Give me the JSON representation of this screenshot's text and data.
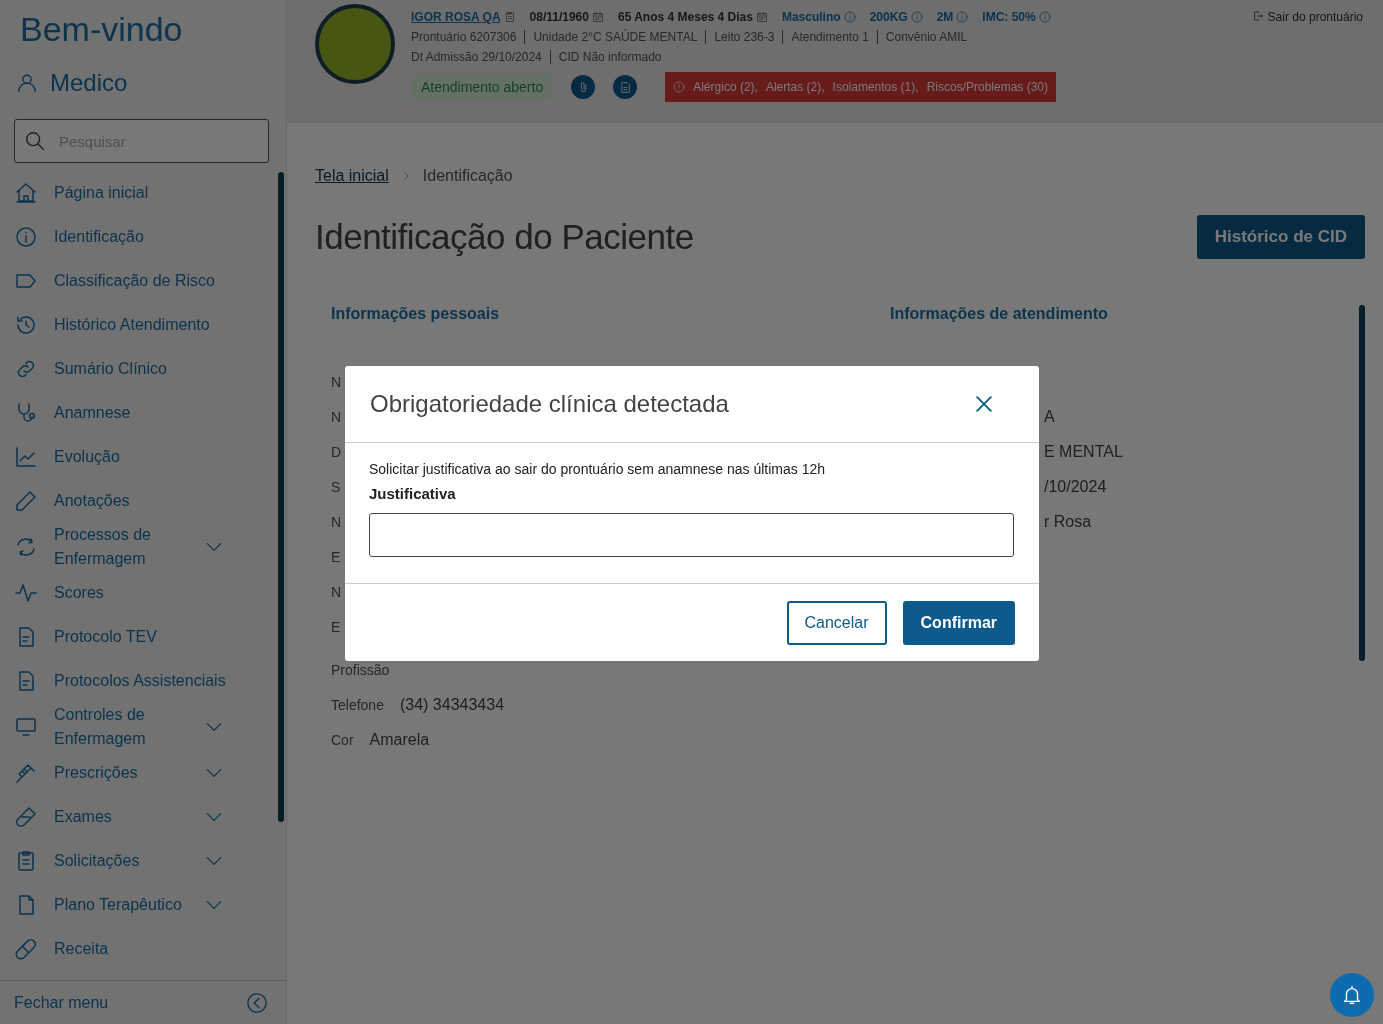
{
  "sidebar": {
    "welcome": "Bem-vindo",
    "user": "Medico",
    "search": {
      "placeholder": "Pesquisar"
    },
    "items": [
      {
        "label": "Página inicial",
        "expandable": false
      },
      {
        "label": "Identificação",
        "expandable": false
      },
      {
        "label": "Classificação de Risco",
        "expandable": false
      },
      {
        "label": "Histórico Atendimento",
        "expandable": false
      },
      {
        "label": "Sumário Clínico",
        "expandable": false
      },
      {
        "label": "Anamnese",
        "expandable": false
      },
      {
        "label": "Evolução",
        "expandable": false
      },
      {
        "label": "Anotações",
        "expandable": false
      },
      {
        "label": "Processos de Enfermagem",
        "expandable": true
      },
      {
        "label": "Scores",
        "expandable": false
      },
      {
        "label": "Protocolo TEV",
        "expandable": false
      },
      {
        "label": "Protocolos Assistenciais",
        "expandable": false
      },
      {
        "label": "Controles de Enfermagem",
        "expandable": true
      },
      {
        "label": "Prescrições",
        "expandable": true
      },
      {
        "label": "Exames",
        "expandable": true
      },
      {
        "label": "Solicitações",
        "expandable": true
      },
      {
        "label": "Plano Terapêutico",
        "expandable": true
      },
      {
        "label": "Receita",
        "expandable": false
      }
    ],
    "footer": "Fechar menu"
  },
  "header": {
    "patient_name": "IGOR ROSA QA",
    "facts": [
      {
        "text": "08/11/1960",
        "kind": "calendar"
      },
      {
        "text": "65 Anos 4 Meses 4 Dias",
        "kind": "calendar"
      },
      {
        "text": "Masculino",
        "kind": "info"
      },
      {
        "text": "200KG",
        "kind": "info"
      },
      {
        "text": "2M",
        "kind": "info"
      },
      {
        "text": "IMC: 50%",
        "kind": "info"
      }
    ],
    "line_1": [
      "Prontuário 6207306",
      "Unidade 2°C SAÚDE MENTAL",
      "Leito 236-3",
      "Atendimento 1",
      "Convênio AMIL"
    ],
    "line_2": [
      "Dt Admissão 29/10/2024",
      "CID Não informado"
    ],
    "status": "Atendimento aberto",
    "alerts": [
      "Alérgico (2),",
      "Alertas (2),",
      "Isolamentos (1),",
      "Riscos/Problemas (30)"
    ],
    "exit_link": "Sair do prontuário"
  },
  "breadcrumb": [
    {
      "label": "Tela inicial",
      "link": true
    },
    {
      "label": "Identificação",
      "link": false
    }
  ],
  "page_title": "Identificação do Paciente",
  "cid_button": "Histórico de CID",
  "personal": {
    "title": "Informações pessoais",
    "rows": [
      {
        "label": "N"
      },
      {
        "label": "N"
      },
      {
        "label": "D"
      },
      {
        "label": "S"
      },
      {
        "label": "N"
      },
      {
        "label": "E"
      },
      {
        "label": "N"
      },
      {
        "label": "E"
      },
      {
        "label": "Profissão"
      },
      {
        "label": "Telefone",
        "value": "(34) 34343434"
      },
      {
        "label": "Cor",
        "value": "Amarela"
      }
    ]
  },
  "attendance": {
    "title": "Informações de atendimento",
    "values": [
      "A",
      "E MENTAL",
      "/10/2024",
      "r Rosa"
    ]
  },
  "modal": {
    "title": "Obrigatoriedade clínica detectada",
    "message": "Solicitar justificativa ao sair do prontuário sem anamnese nas últimas 12h",
    "field_label": "Justificativa",
    "buttons": [
      {
        "label": "Cancelar",
        "kind": "secondary"
      },
      {
        "label": "Confirmar",
        "kind": "primary"
      }
    ]
  }
}
